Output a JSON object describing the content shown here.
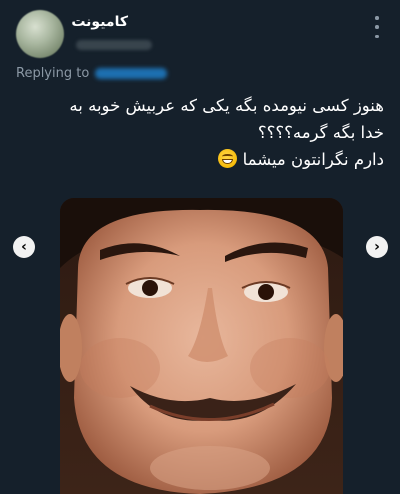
{
  "tweet": {
    "author_name": "کامیونت",
    "replying_prefix": "Replying to",
    "text_lines": [
      "هنوز کسی نیومده بگه یکی که عربیش خوبه به",
      "خدا بگه گرمه؟؟؟؟",
      "دارم نگرانتون میشما"
    ],
    "emoji": "grinning-sweat-face"
  },
  "media": {
    "arrow_prev": "‹",
    "arrow_next": "›"
  },
  "colors": {
    "background": "#15202b",
    "secondary_text": "#8b98a5",
    "link": "#1d9bf0"
  }
}
